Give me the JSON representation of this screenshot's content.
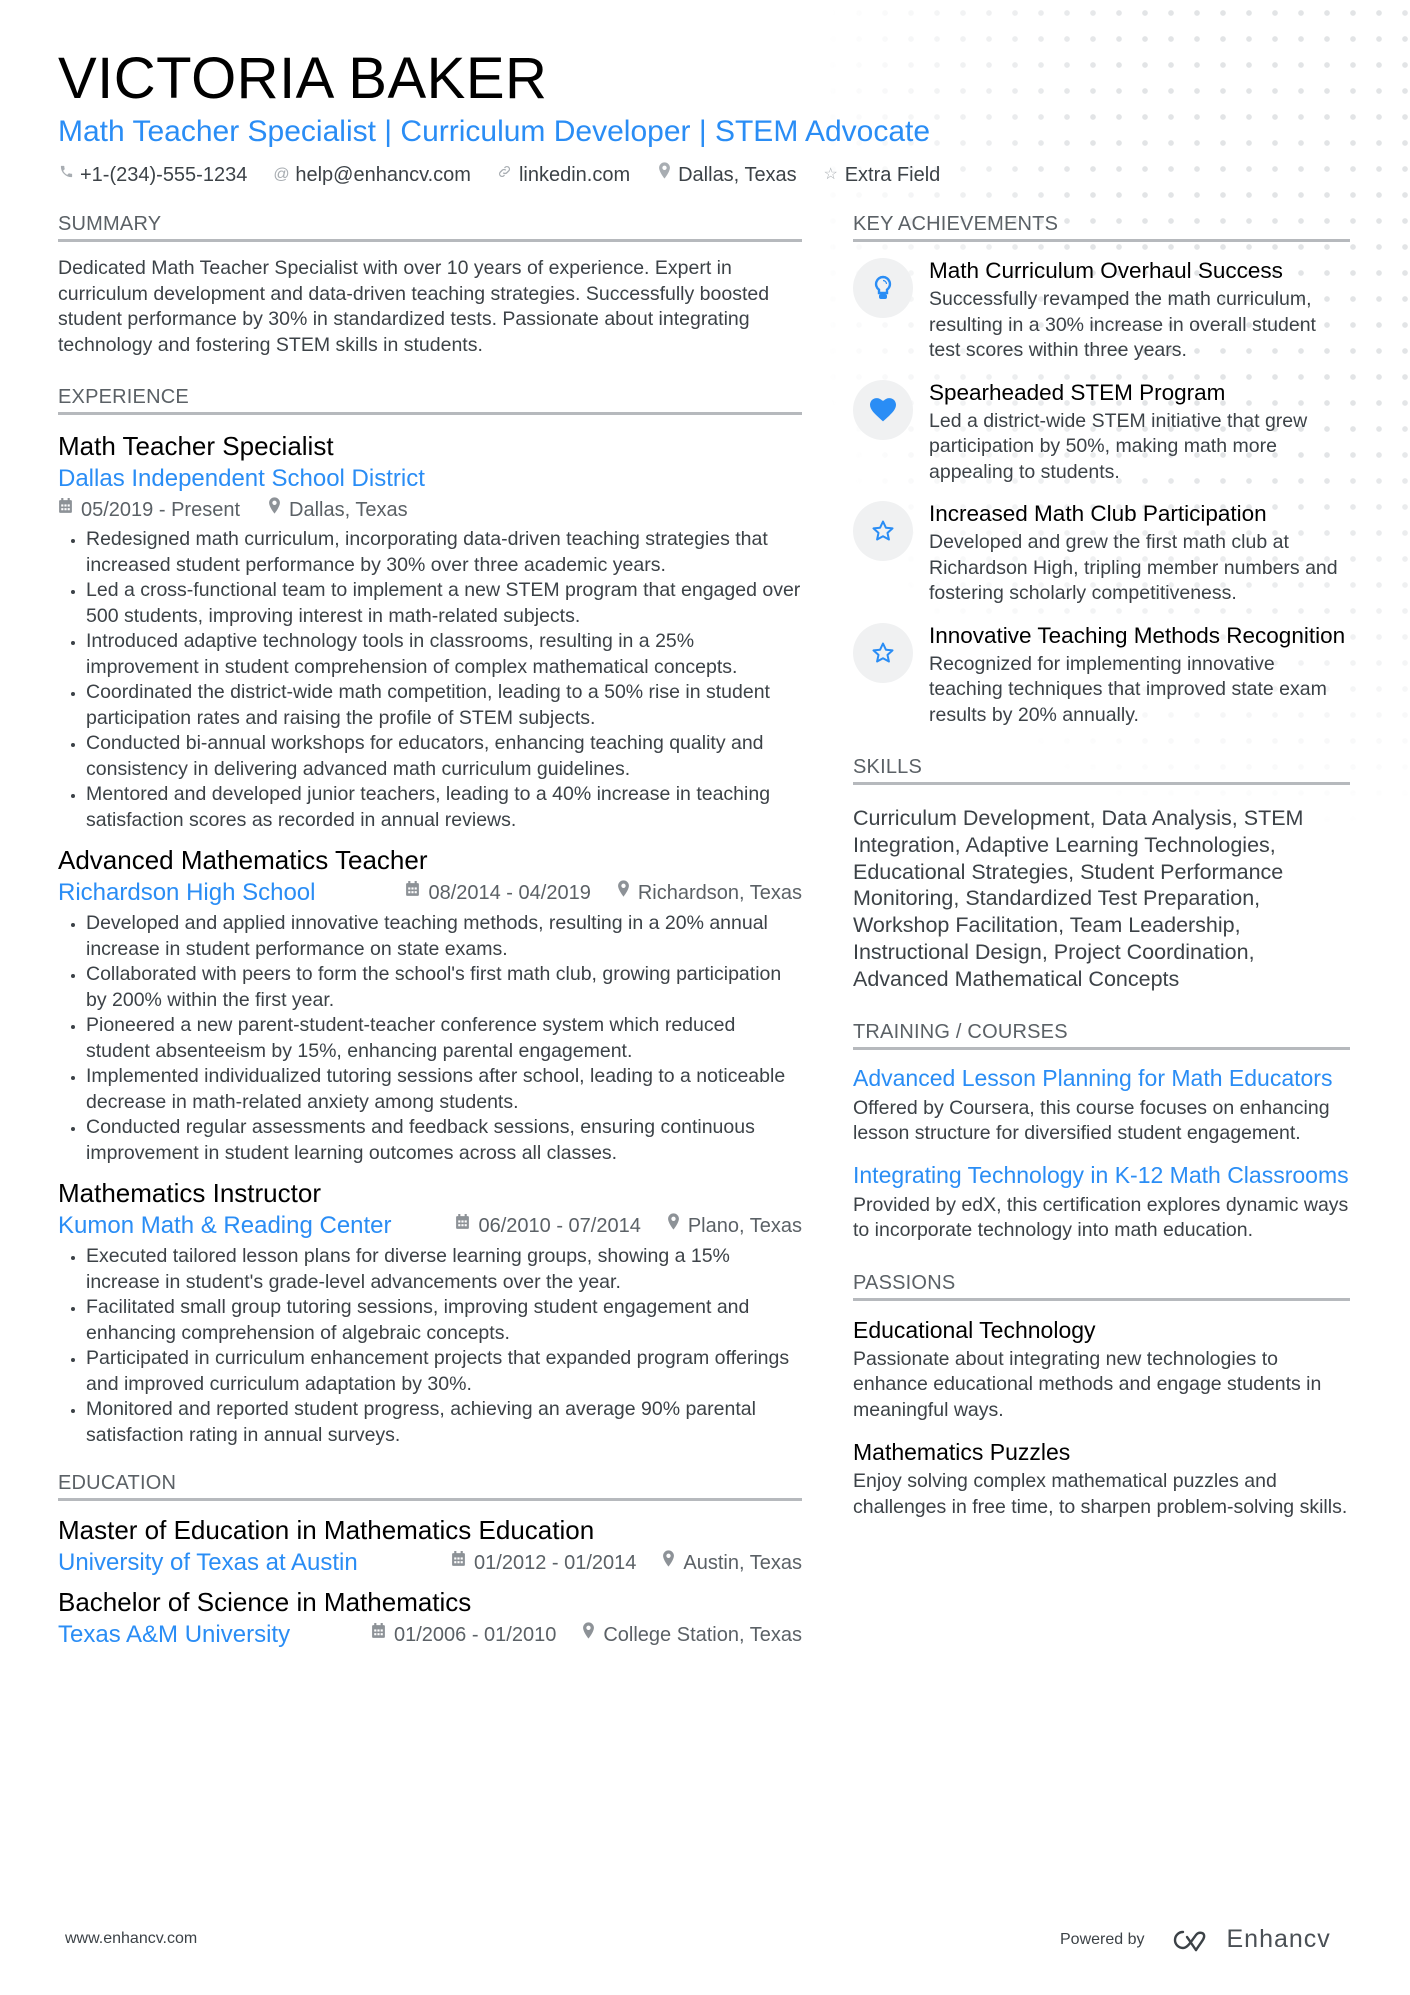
{
  "header": {
    "name": "VICTORIA BAKER",
    "tagline": "Math Teacher Specialist | Curriculum Developer | STEM Advocate",
    "contacts": [
      {
        "icon": "phone-icon",
        "glyph": "✆",
        "text": "+1-(234)-555-1234"
      },
      {
        "icon": "at-icon",
        "glyph": "@",
        "text": "help@enhancv.com"
      },
      {
        "icon": "link-icon",
        "glyph": "🔗",
        "text": "linkedin.com"
      },
      {
        "icon": "location-icon",
        "glyph": "⚲",
        "text": "Dallas, Texas"
      },
      {
        "icon": "star-icon",
        "glyph": "☆",
        "text": "Extra Field"
      }
    ]
  },
  "summary": {
    "title": "SUMMARY",
    "text": "Dedicated Math Teacher Specialist with over 10 years of experience. Expert in curriculum development and data-driven teaching strategies. Successfully boosted student performance by 30% in standardized tests. Passionate about integrating technology and fostering STEM skills in students."
  },
  "experience": {
    "title": "EXPERIENCE",
    "jobs": [
      {
        "title": "Math Teacher Specialist",
        "company": "Dallas Independent School District",
        "dates": "05/2019 - Present",
        "location": "Dallas, Texas",
        "bullets": [
          "Redesigned math curriculum, incorporating data-driven teaching strategies that increased student performance by 30% over three academic years.",
          "Led a cross-functional team to implement a new STEM program that engaged over 500 students, improving interest in math-related subjects.",
          "Introduced adaptive technology tools in classrooms, resulting in a 25% improvement in student comprehension of complex mathematical concepts.",
          "Coordinated the district-wide math competition, leading to a 50% rise in student participation rates and raising the profile of STEM subjects.",
          "Conducted bi-annual workshops for educators, enhancing teaching quality and consistency in delivering advanced math curriculum guidelines.",
          "Mentored and developed junior teachers, leading to a 40% increase in teaching satisfaction scores as recorded in annual reviews."
        ]
      },
      {
        "title": "Advanced Mathematics Teacher",
        "company": "Richardson High School",
        "dates": "08/2014 - 04/2019",
        "location": "Richardson, Texas",
        "bullets": [
          "Developed and applied innovative teaching methods, resulting in a 20% annual increase in student performance on state exams.",
          "Collaborated with peers to form the school's first math club, growing participation by 200% within the first year.",
          "Pioneered a new parent-student-teacher conference system which reduced student absenteeism by 15%, enhancing parental engagement.",
          "Implemented individualized tutoring sessions after school, leading to a noticeable decrease in math-related anxiety among students.",
          "Conducted regular assessments and feedback sessions, ensuring continuous improvement in student learning outcomes across all classes."
        ]
      },
      {
        "title": "Mathematics Instructor",
        "company": "Kumon Math & Reading Center",
        "dates": "06/2010 - 07/2014",
        "location": "Plano, Texas",
        "bullets": [
          "Executed tailored lesson plans for diverse learning groups, showing a 15% increase in student's grade-level advancements over the year.",
          "Facilitated small group tutoring sessions, improving student engagement and enhancing comprehension of algebraic concepts.",
          "Participated in curriculum enhancement projects that expanded program offerings and improved curriculum adaptation by 30%.",
          "Monitored and reported student progress, achieving an average 90% parental satisfaction rating in annual surveys."
        ]
      }
    ]
  },
  "education": {
    "title": "EDUCATION",
    "items": [
      {
        "degree": "Master of Education in Mathematics Education",
        "school": "University of Texas at Austin",
        "dates": "01/2012 - 01/2014",
        "location": "Austin, Texas"
      },
      {
        "degree": "Bachelor of Science in Mathematics",
        "school": "Texas A&M University",
        "dates": "01/2006 - 01/2010",
        "location": "College Station, Texas"
      }
    ]
  },
  "achievements": {
    "title": "KEY ACHIEVEMENTS",
    "items": [
      {
        "icon": "lightbulb-icon",
        "title": "Math Curriculum Overhaul Success",
        "desc": "Successfully revamped the math curriculum, resulting in a 30% increase in overall student test scores within three years."
      },
      {
        "icon": "heart-icon",
        "title": "Spearheaded STEM Program",
        "desc": "Led a district-wide STEM initiative that grew participation by 50%, making math more appealing to students."
      },
      {
        "icon": "star-icon",
        "title": "Increased Math Club Participation",
        "desc": "Developed and grew the first math club at Richardson High, tripling member numbers and fostering scholarly competitiveness."
      },
      {
        "icon": "star-icon",
        "title": "Innovative Teaching Methods Recognition",
        "desc": "Recognized for implementing innovative teaching techniques that improved state exam results by 20% annually."
      }
    ]
  },
  "skills": {
    "title": "SKILLS",
    "text": "Curriculum Development, Data Analysis, STEM Integration, Adaptive Learning Technologies, Educational Strategies, Student Performance Monitoring, Standardized Test Preparation, Workshop Facilitation, Team Leadership, Instructional Design, Project Coordination, Advanced Mathematical Concepts"
  },
  "training": {
    "title": "TRAINING / COURSES",
    "items": [
      {
        "title": "Advanced Lesson Planning for Math Educators",
        "desc": "Offered by Coursera, this course focuses on enhancing lesson structure for diversified student engagement."
      },
      {
        "title": "Integrating Technology in K-12 Math Classrooms",
        "desc": "Provided by edX, this certification explores dynamic ways to incorporate technology into math education."
      }
    ]
  },
  "passions": {
    "title": "PASSIONS",
    "items": [
      {
        "title": "Educational Technology",
        "desc": "Passionate about integrating new technologies to enhance educational methods and engage students in meaningful ways."
      },
      {
        "title": "Mathematics Puzzles",
        "desc": "Enjoy solving complex mathematical puzzles and challenges in free time, to sharpen problem-solving skills."
      }
    ]
  },
  "footer": {
    "website": "www.enhancv.com",
    "powered_by": "Powered by",
    "brand": "Enhancv"
  },
  "colors": {
    "accent": "#2a8df5",
    "text": "#3c4247",
    "heading": "#000000",
    "section_rule": "#b6b9bd",
    "icon_bg": "#f0f1f2"
  }
}
